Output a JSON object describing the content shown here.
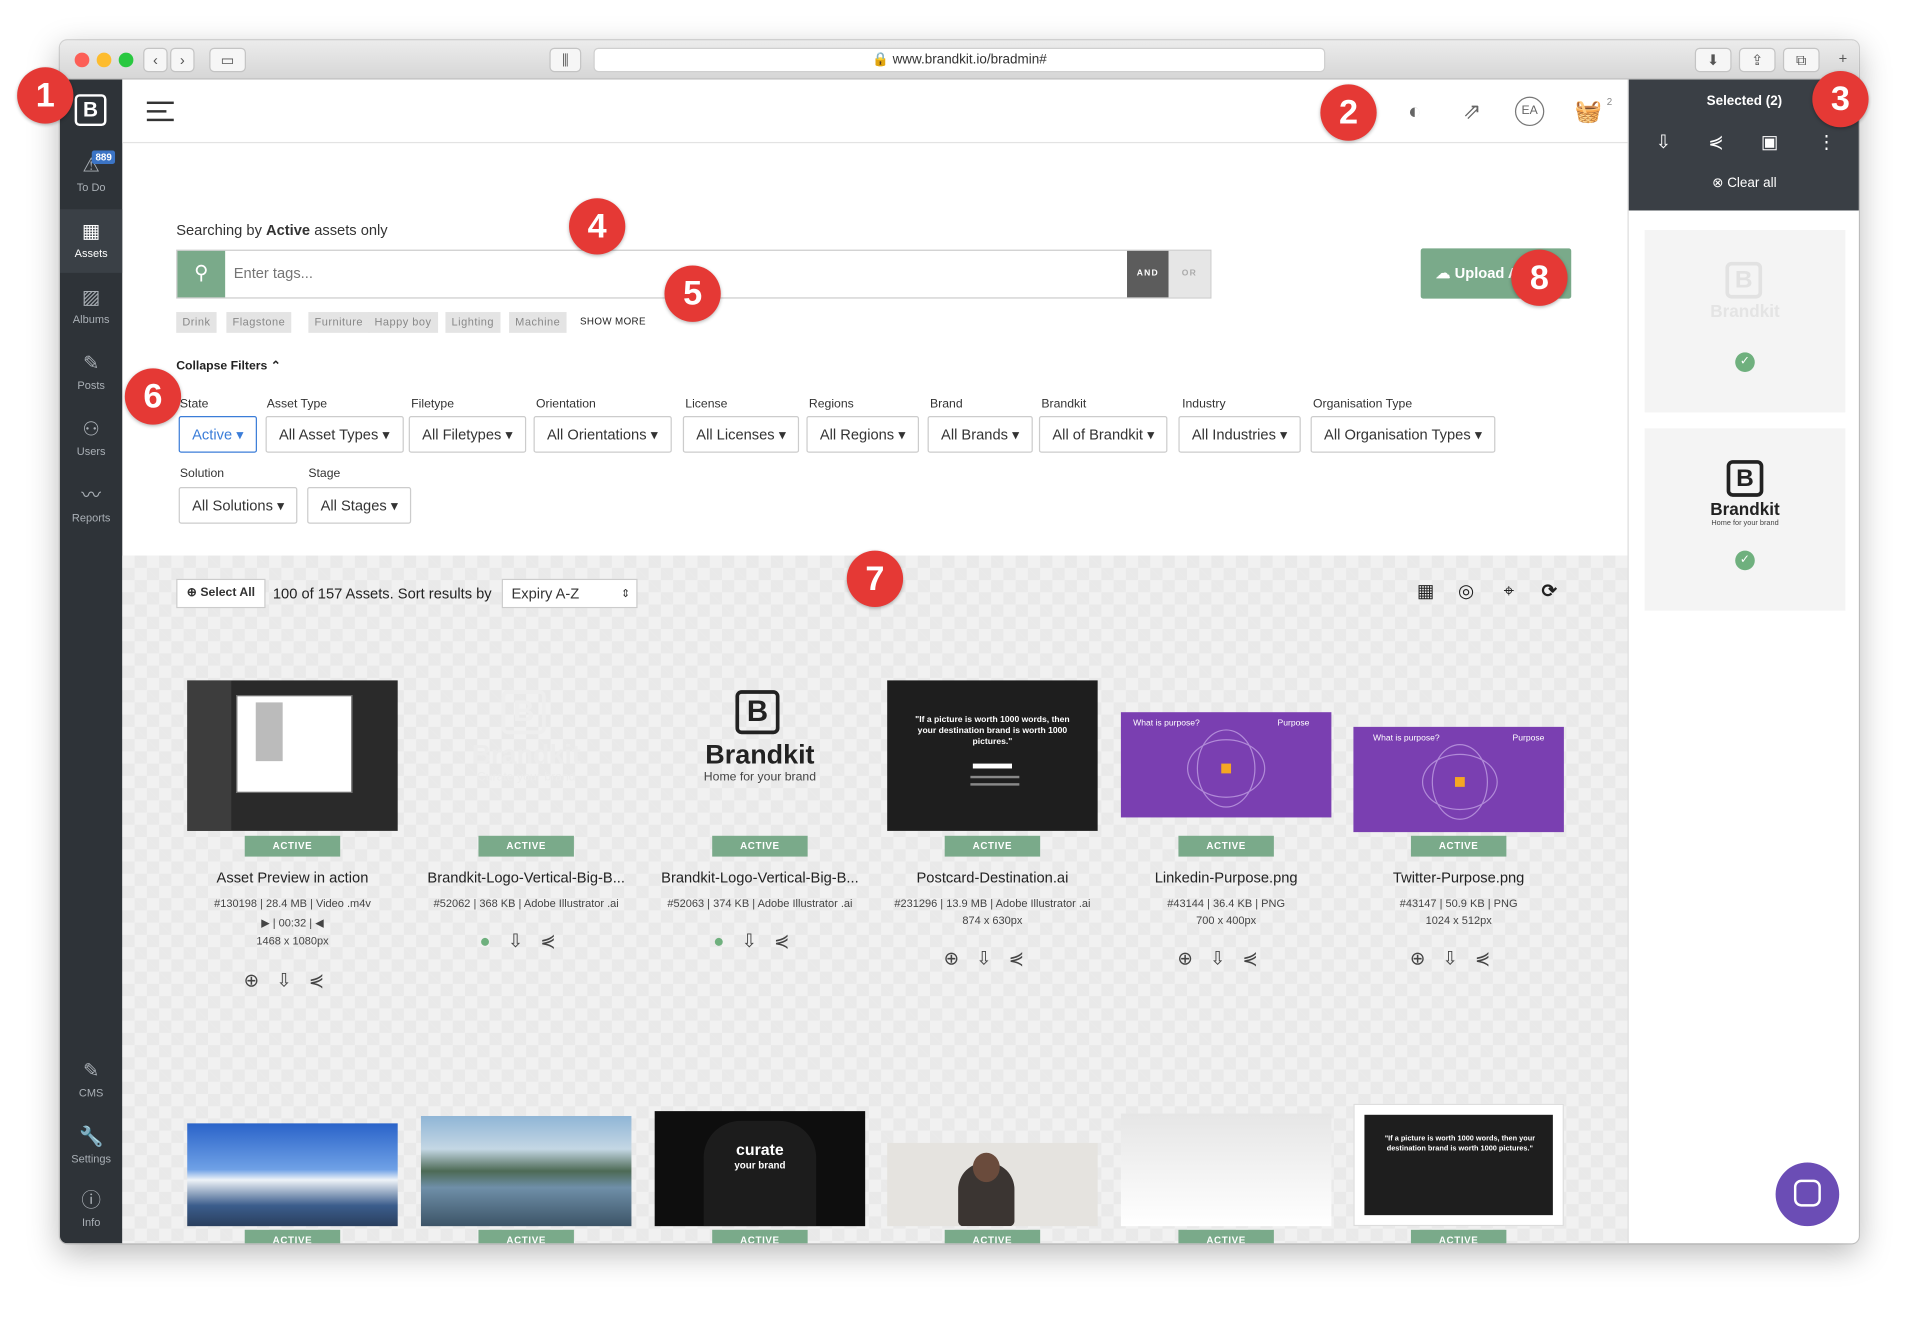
{
  "browser": {
    "url": "www.brandkit.io/bradmin#"
  },
  "sidebar": {
    "items": [
      {
        "label": "To Do",
        "badge": "889",
        "icon": "warning-icon"
      },
      {
        "label": "Assets",
        "icon": "grid-icon"
      },
      {
        "label": "Albums",
        "icon": "image-icon"
      },
      {
        "label": "Posts",
        "icon": "edit-icon"
      },
      {
        "label": "Users",
        "icon": "users-icon"
      },
      {
        "label": "Reports",
        "icon": "pulse-icon"
      }
    ],
    "bottom": [
      {
        "label": "CMS",
        "icon": "edit-icon"
      },
      {
        "label": "Settings",
        "icon": "wrench-icon"
      },
      {
        "label": "Info",
        "icon": "info-icon"
      }
    ]
  },
  "topbar": {
    "avatar": "EA",
    "basket_count": "2"
  },
  "search": {
    "prefix": "Searching by ",
    "state": "Active",
    "suffix": " assets only",
    "placeholder": "Enter tags...",
    "and_label": "AND",
    "or_label": "OR",
    "tags": [
      "Drink",
      "Flagstone",
      "Furniture",
      "Happy boy",
      "Lighting",
      "Machine"
    ],
    "show_more": "SHOW MORE",
    "collapse": "Collapse Filters",
    "upload": "Upload Assets"
  },
  "filters": [
    {
      "label": "State",
      "value": "Active"
    },
    {
      "label": "Asset Type",
      "value": "All Asset Types"
    },
    {
      "label": "Filetype",
      "value": "All Filetypes"
    },
    {
      "label": "Orientation",
      "value": "All Orientations"
    },
    {
      "label": "License",
      "value": "All Licenses"
    },
    {
      "label": "Regions",
      "value": "All Regions"
    },
    {
      "label": "Brand",
      "value": "All Brands"
    },
    {
      "label": "Brandkit",
      "value": "All of Brandkit"
    },
    {
      "label": "Industry",
      "value": "All Industries"
    },
    {
      "label": "Organisation Type",
      "value": "All Organisation Types"
    },
    {
      "label": "Solution",
      "value": "All Solutions"
    },
    {
      "label": "Stage",
      "value": "All Stages"
    }
  ],
  "results": {
    "select_all": "Select All",
    "summary": "100 of 157 Assets. Sort results by",
    "sort": "Expiry A-Z"
  },
  "assets": [
    {
      "status": "ACTIVE",
      "name": "Asset Preview in action",
      "meta1": "#130198 | 28.4 MB | Video .m4v",
      "meta2": "▶ | 00:32 | ◀",
      "meta3": "1468 x 1080px"
    },
    {
      "status": "ACTIVE",
      "name": "Brandkit-Logo-Vertical-Big-B...",
      "meta1": "#52062 | 368 KB | Adobe Illustrator .ai",
      "meta2": "",
      "meta3": ""
    },
    {
      "status": "ACTIVE",
      "name": "Brandkit-Logo-Vertical-Big-B...",
      "meta1": "#52063 | 374 KB | Adobe Illustrator .ai",
      "meta2": "",
      "meta3": ""
    },
    {
      "status": "ACTIVE",
      "name": "Postcard-Destination.ai",
      "meta1": "#231296 | 13.9 MB | Adobe Illustrator .ai",
      "meta2": "874 x 630px",
      "meta3": ""
    },
    {
      "status": "ACTIVE",
      "name": "Linkedin-Purpose.png",
      "meta1": "#43144 | 36.4 KB | PNG",
      "meta2": "700 x 400px",
      "meta3": ""
    },
    {
      "status": "ACTIVE",
      "name": "Twitter-Purpose.png",
      "meta1": "#43147 | 50.9 KB | PNG",
      "meta2": "1024 x 512px",
      "meta3": ""
    }
  ],
  "row2_status": "ACTIVE",
  "thumb_text": {
    "brandkit": "Brandkit",
    "tagline": "Home for your brand",
    "tagline_white": "Curate your brand",
    "quote": "\"If a picture is worth 1000 words, then your destination brand is worth 1000 pictures.\"",
    "what_is_purpose": "What is purpose?",
    "purpose": "Purpose",
    "curate": "curate",
    "your_brand": "your brand"
  },
  "selected_panel": {
    "title": "Selected (2)",
    "clear": "Clear all"
  },
  "callouts": [
    "1",
    "2",
    "3",
    "4",
    "5",
    "6",
    "7",
    "8"
  ],
  "colors": {
    "accent_green": "#7aaa8a",
    "sidebar": "#2e3338",
    "callout_red": "#e53935",
    "link_blue": "#3b7dd8"
  }
}
